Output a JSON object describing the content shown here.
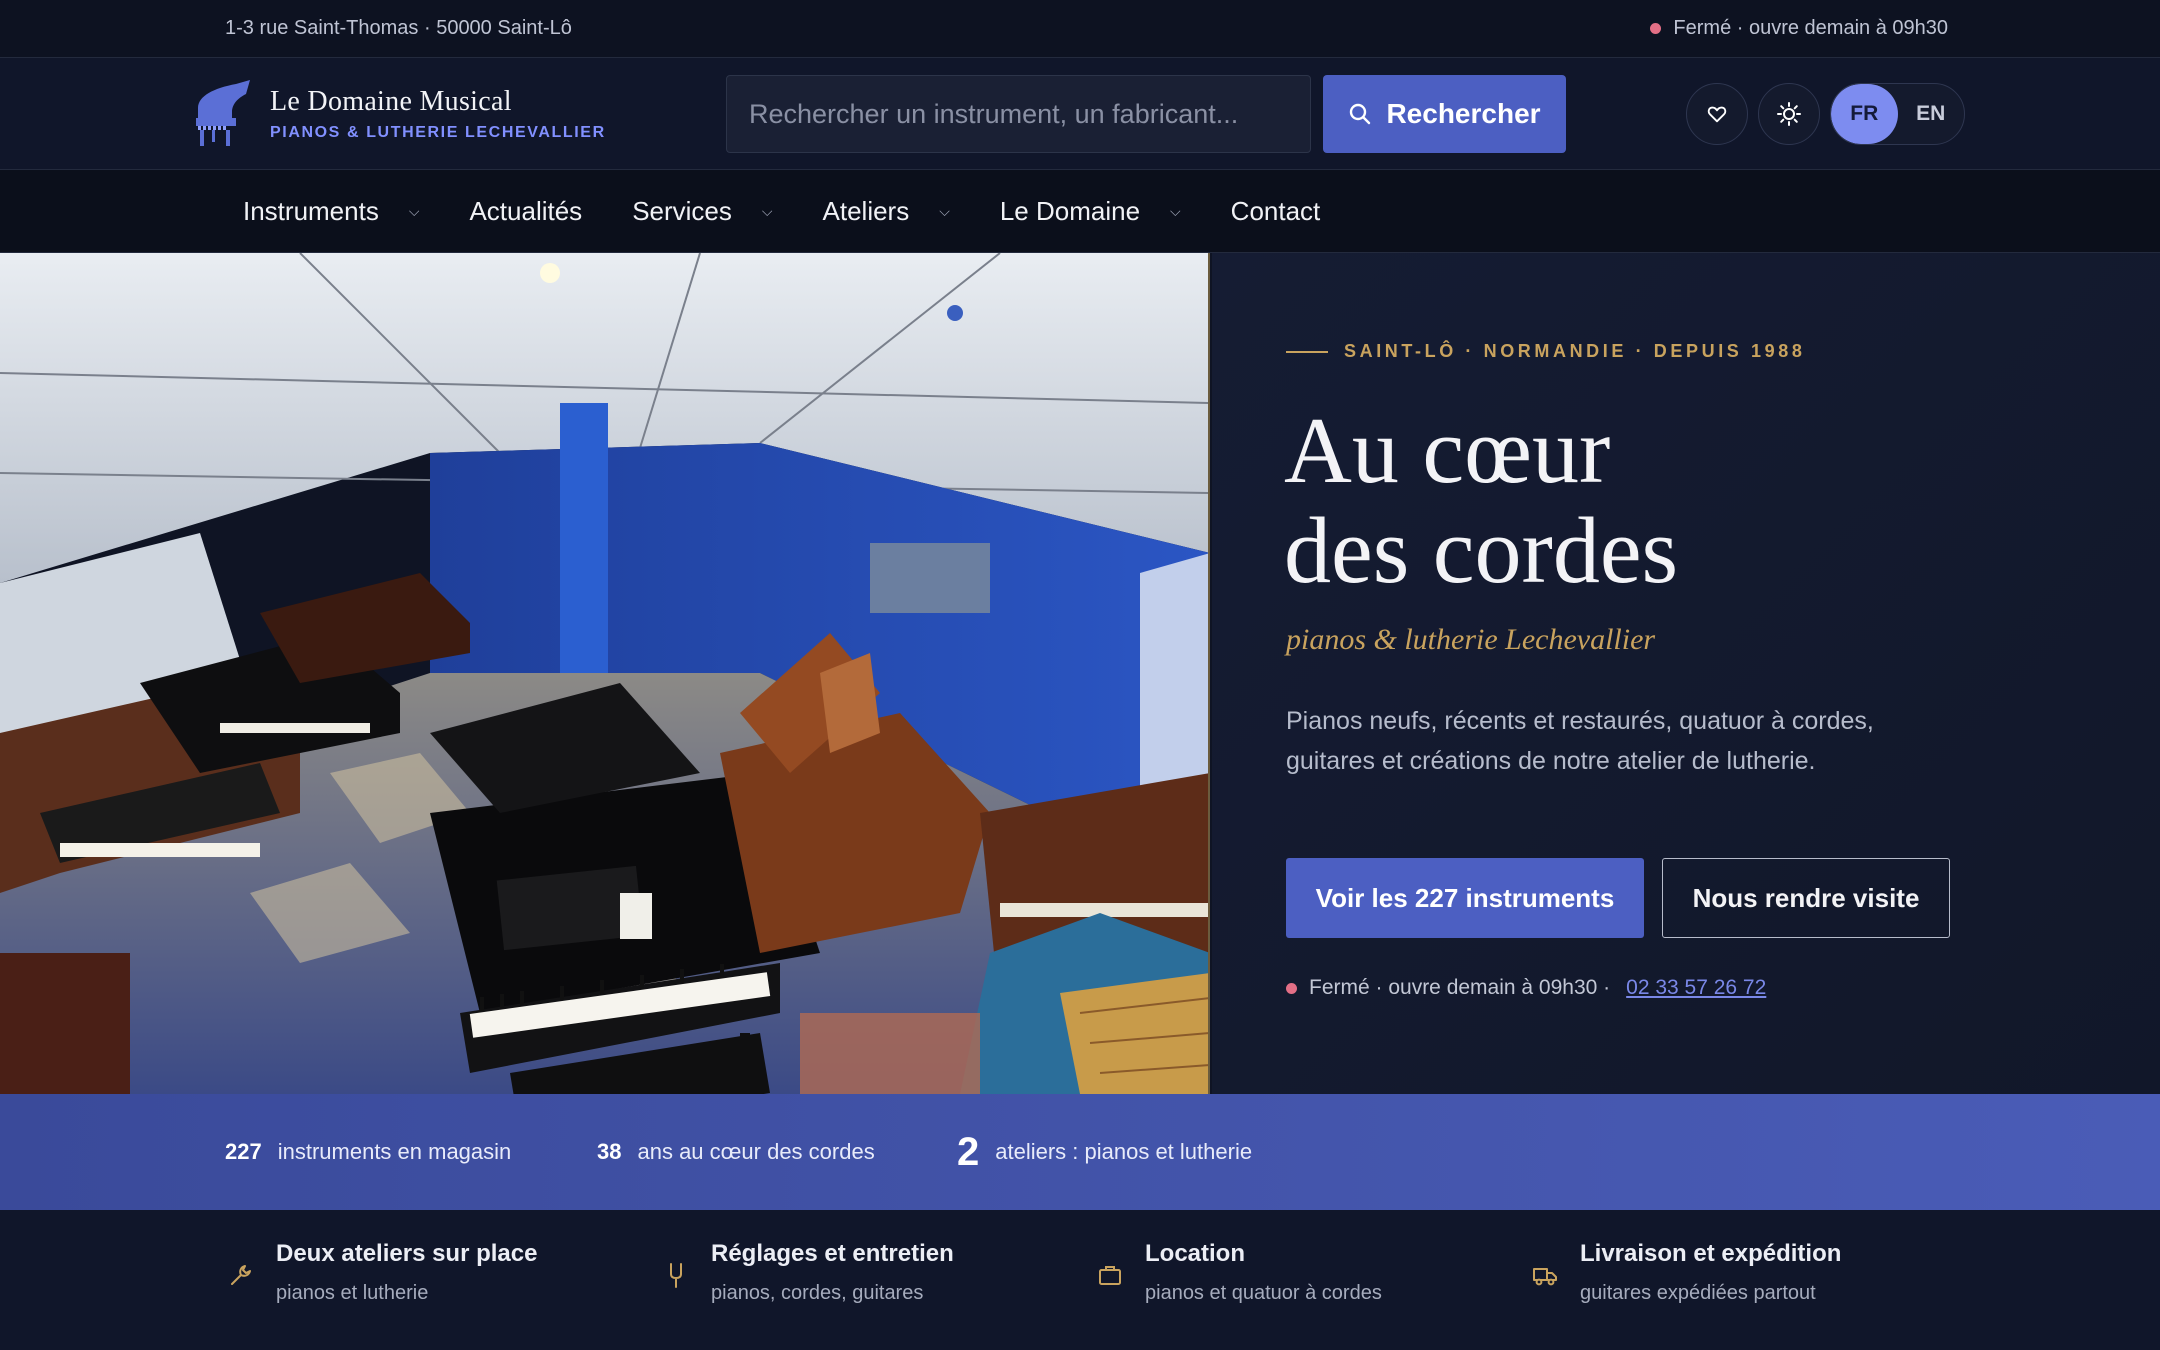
{
  "topbar": {
    "address": "1-3 rue Saint-Thomas · 50000 Saint-Lô",
    "status": "Fermé · ouvre demain à 09h30"
  },
  "header": {
    "logo_name": "Le Domaine Musical",
    "logo_sub": "PIANOS & LUTHERIE LECHEVALLIER",
    "search_placeholder": "Rechercher un instrument, un fabricant...",
    "search_button": "Rechercher",
    "lang_fr": "FR",
    "lang_en": "EN"
  },
  "nav": {
    "items": [
      "Instruments",
      "Actualités",
      "Services",
      "Ateliers",
      "Le Domaine",
      "Contact"
    ]
  },
  "hero": {
    "eyebrow": "SAINT-LÔ · NORMANDIE · DEPUIS 1988",
    "title_line1": "Au cœur",
    "title_line2": "des cordes",
    "tagline": "pianos & lutherie Lechevallier",
    "description": "Pianos neufs, récents et restaurés, quatuor à cordes, guitares et créations de notre atelier de lutherie.",
    "cta_primary": "Voir les 227 instruments",
    "cta_secondary": "Nous rendre visite",
    "status": "Fermé · ouvre demain à 09h30 ·",
    "phone": "02 33 57 26 72"
  },
  "stats": [
    {
      "value": "227",
      "label": "instruments en magasin"
    },
    {
      "value": "38",
      "label": "ans au cœur des cordes"
    },
    {
      "value": "2",
      "label": "ateliers : pianos et lutherie"
    }
  ],
  "features": [
    {
      "icon": "wrench-icon",
      "title": "Deux ateliers sur place",
      "subtitle": "pianos et lutherie"
    },
    {
      "icon": "tuning-fork-icon",
      "title": "Réglages et entretien",
      "subtitle": "pianos, cordes, guitares"
    },
    {
      "icon": "briefcase-icon",
      "title": "Location",
      "subtitle": "pianos et quatuor à cordes"
    },
    {
      "icon": "truck-icon",
      "title": "Livraison et expédition",
      "subtitle": "guitares expédiées partout"
    }
  ],
  "colors": {
    "accent": "#4c5fc2",
    "gold": "#c9a35e",
    "status_closed": "#e36f86",
    "background": "#0f1424"
  }
}
